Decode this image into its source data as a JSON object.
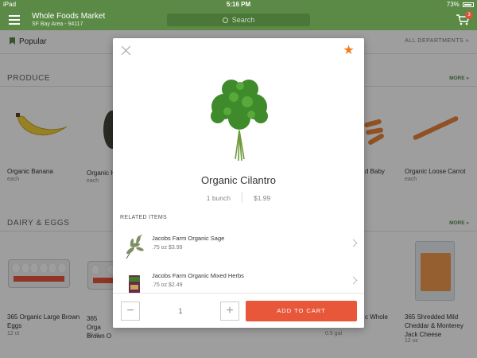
{
  "status_bar": {
    "carrier": "iPad",
    "time": "5:16 PM",
    "battery": "73%"
  },
  "header": {
    "store_name": "Whole Foods Market",
    "store_area": "SF Bay Area - 94117",
    "search_placeholder": "Search",
    "cart_count": "3"
  },
  "nav": {
    "popular": "Popular",
    "all_departments": "ALL DEPARTMENTS »"
  },
  "sections": [
    {
      "title": "PRODUCE",
      "more": "MORE »",
      "items": [
        {
          "name": "Organic Banana",
          "unit": "each"
        },
        {
          "name": "Organic H",
          "unit": "each"
        },
        {
          "name": "d Baby",
          "unit": ""
        },
        {
          "name": "Organic Loose Carrot",
          "unit": "each"
        }
      ]
    },
    {
      "title": "DAIRY & EGGS",
      "more": "MORE »",
      "items": [
        {
          "name": "365 Organic Large Brown Eggs",
          "unit": "12 ct"
        },
        {
          "name": "365 Orga Brown O",
          "unit": "12 ct"
        },
        {
          "name": "c Whole",
          "unit": "0.5 gal"
        },
        {
          "name": "365 Shredded Mild Cheddar & Monterey Jack Cheese",
          "unit": "12 oz"
        }
      ]
    }
  ],
  "modal": {
    "product_name": "Organic Cilantro",
    "unit": "1 bunch",
    "price": "$1.99",
    "related_header": "RELATED ITEMS",
    "related": [
      {
        "name": "Jacobs Farm Organic Sage",
        "price": ".75 oz $3.99"
      },
      {
        "name": "Jacobs Farm Organic Mixed Herbs",
        "price": ".75 oz $2.49"
      }
    ],
    "quantity": "1",
    "decrement": "−",
    "increment": "+",
    "add_to_cart": "ADD TO CART"
  }
}
